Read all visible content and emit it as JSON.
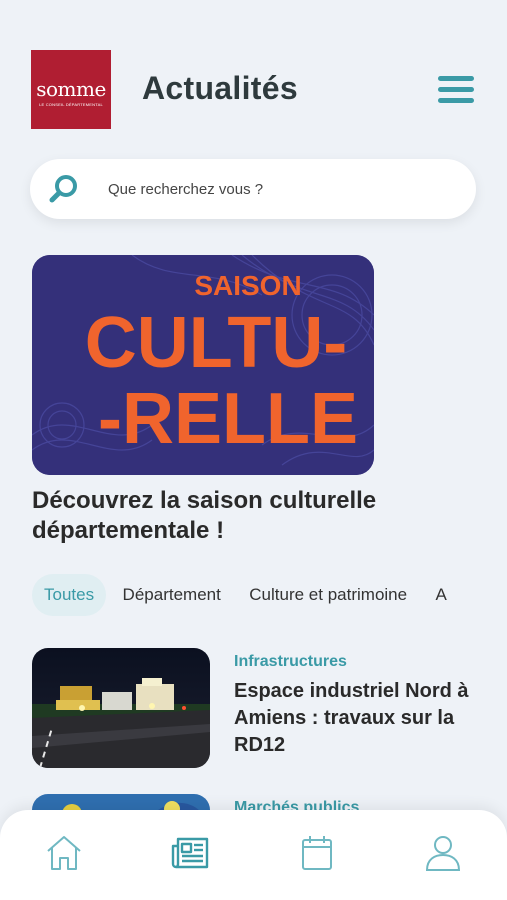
{
  "header": {
    "logo": {
      "word": "somme",
      "subtitle": "le conseil départemental"
    },
    "title": "Actualités",
    "menu_icon": "hamburger-menu-icon"
  },
  "search": {
    "placeholder": "Que recherchez vous ?",
    "value": "",
    "icon": "search-icon"
  },
  "featured": {
    "image_lines": [
      "SAISON",
      "CULTU-",
      "-RELLE"
    ],
    "title": "Découvrez la saison culturelle départementale !"
  },
  "tabs": [
    {
      "label": "Toutes",
      "active": true
    },
    {
      "label": "Département",
      "active": false
    },
    {
      "label": "Culture et patrimoine",
      "active": false
    },
    {
      "label": "A",
      "active": false
    }
  ],
  "articles": [
    {
      "category": "Infrastructures",
      "title": "Espace industriel Nord à Amiens : travaux sur la RD12"
    },
    {
      "category": "Marchés publics",
      "title": ""
    }
  ],
  "bottom_nav": [
    {
      "name": "home",
      "icon": "home-icon"
    },
    {
      "name": "news",
      "icon": "newspaper-icon",
      "active": true
    },
    {
      "name": "agenda",
      "icon": "calendar-icon"
    },
    {
      "name": "profile",
      "icon": "user-icon"
    }
  ],
  "colors": {
    "accent": "#3a9aa6",
    "brand": "#b01e32",
    "poster_bg": "#34307a",
    "poster_text": "#f0642d",
    "background": "#eef2f7"
  }
}
